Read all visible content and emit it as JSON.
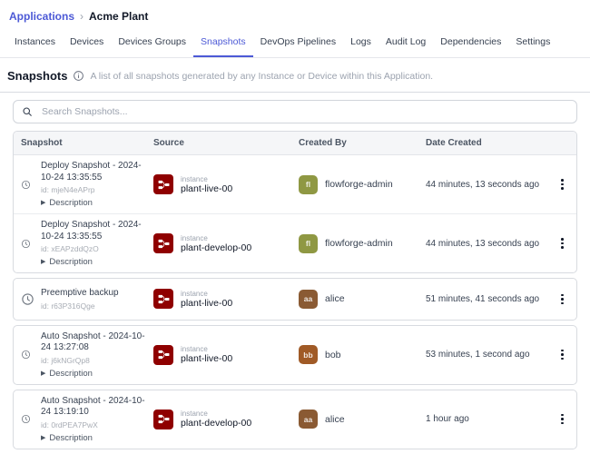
{
  "breadcrumb": {
    "link": "Applications",
    "separator": "›",
    "current": "Acme Plant"
  },
  "tabs": [
    {
      "label": "Instances",
      "active": false
    },
    {
      "label": "Devices",
      "active": false
    },
    {
      "label": "Devices Groups",
      "active": false
    },
    {
      "label": "Snapshots",
      "active": true
    },
    {
      "label": "DevOps Pipelines",
      "active": false
    },
    {
      "label": "Logs",
      "active": false
    },
    {
      "label": "Audit Log",
      "active": false
    },
    {
      "label": "Dependencies",
      "active": false
    },
    {
      "label": "Settings",
      "active": false
    }
  ],
  "section": {
    "title": "Snapshots",
    "description": "A list of all snapshots generated by any Instance or Device within this Application."
  },
  "search": {
    "placeholder": "Search Snapshots..."
  },
  "icons": {
    "expand_triangle": "▶"
  },
  "table": {
    "columns": [
      "Snapshot",
      "Source",
      "Created By",
      "Date Created"
    ],
    "groups": [
      [
        0,
        1
      ],
      [
        2
      ],
      [
        3
      ],
      [
        4
      ]
    ]
  },
  "rows": [
    {
      "title": "Deploy Snapshot - 2024-10-24 13:35:55",
      "id": "id: mjeN4eAPrp",
      "has_description": true,
      "description_label": "Description",
      "source_type": "instance",
      "source_name": "plant-live-00",
      "creator": "flowforge-admin",
      "avatar_initials": "fl",
      "avatar_color": "#8F9843",
      "date": "44 minutes, 13 seconds ago"
    },
    {
      "title": "Deploy Snapshot - 2024-10-24 13:35:55",
      "id": "id: xEAPzddQzO",
      "has_description": true,
      "description_label": "Description",
      "source_type": "instance",
      "source_name": "plant-develop-00",
      "creator": "flowforge-admin",
      "avatar_initials": "fl",
      "avatar_color": "#8F9843",
      "date": "44 minutes, 13 seconds ago"
    },
    {
      "title": "Preemptive backup",
      "id": "id: r63P316Qge",
      "has_description": false,
      "description_label": "Description",
      "source_type": "instance",
      "source_name": "plant-live-00",
      "creator": "alice",
      "avatar_initials": "aa",
      "avatar_color": "#8A5A33",
      "date": "51 minutes, 41 seconds ago"
    },
    {
      "title": "Auto Snapshot - 2024-10-24 13:27:08",
      "id": "id: j6kNGrQp8",
      "has_description": true,
      "description_label": "Description",
      "source_type": "instance",
      "source_name": "plant-live-00",
      "creator": "bob",
      "avatar_initials": "bb",
      "avatar_color": "#A05A26",
      "date": "53 minutes, 1 second ago"
    },
    {
      "title": "Auto Snapshot - 2024-10-24 13:19:10",
      "id": "id: 0rdPEA7PwX",
      "has_description": true,
      "description_label": "Description",
      "source_type": "instance",
      "source_name": "plant-develop-00",
      "creator": "alice",
      "avatar_initials": "aa",
      "avatar_color": "#8A5A33",
      "date": "1 hour ago"
    }
  ],
  "colors": {
    "accent": "#4C59D6",
    "node_red": "#8F0000"
  }
}
